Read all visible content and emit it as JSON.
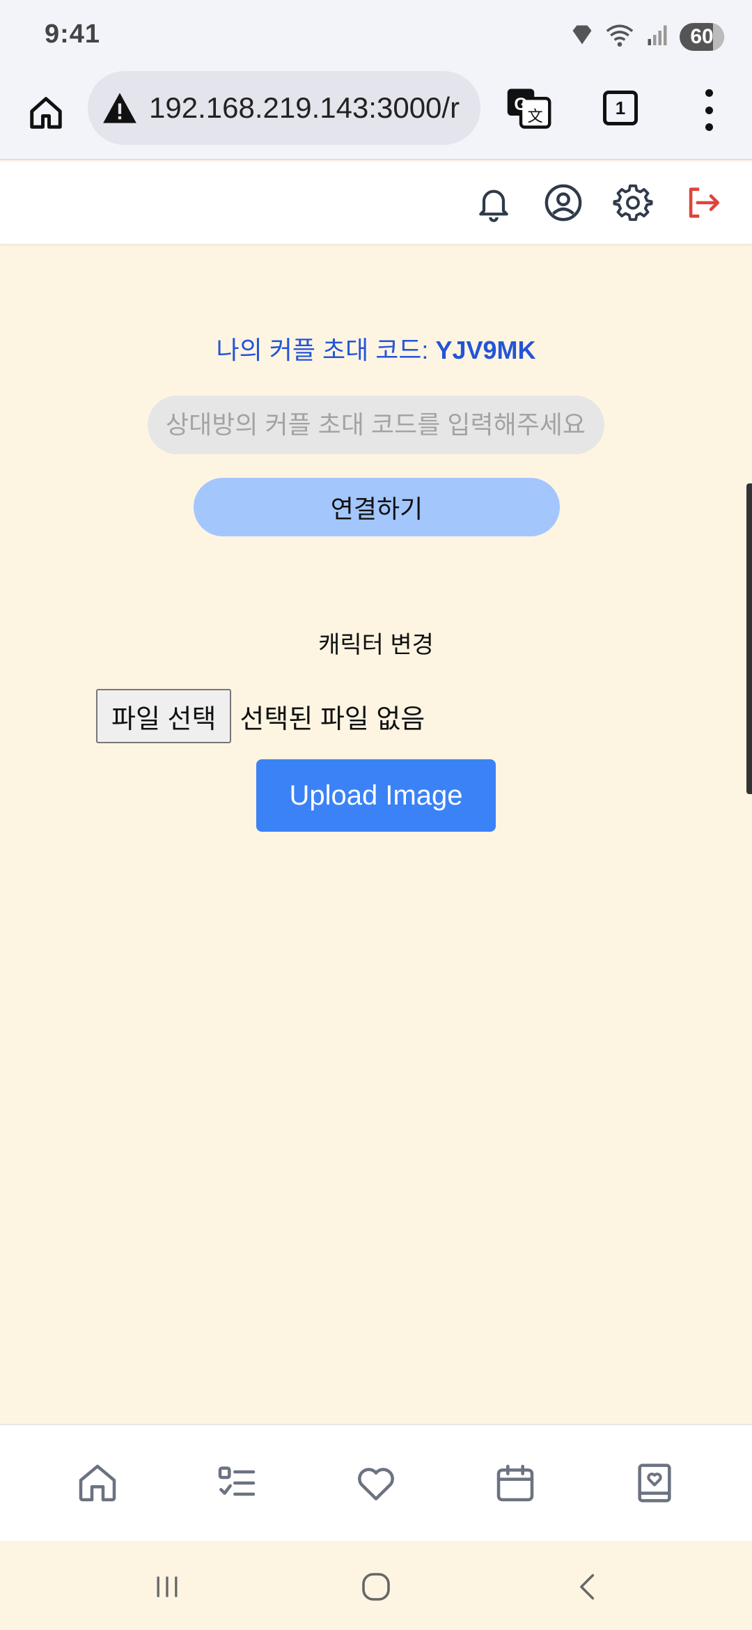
{
  "status_bar": {
    "time": "9:41",
    "battery": "60",
    "icons": [
      "signal-diamond-icon",
      "wifi-icon",
      "cell-signal-icon",
      "battery-icon"
    ]
  },
  "browser": {
    "url": "192.168.219.143:3000/r",
    "url_warning_icon": "warning-icon",
    "tab_count": "1"
  },
  "header": {
    "icons": [
      "bell-icon",
      "profile-icon",
      "settings-icon",
      "logout-icon"
    ],
    "logout_color": "#e0443a"
  },
  "invite": {
    "label": "나의 커플 초대 코드: ",
    "code": "YJV9MK",
    "input_placeholder": "상대방의 커플 초대 코드를 입력해주세요",
    "connect_label": "연결하기"
  },
  "character": {
    "title": "캐릭터 변경",
    "file_button_label": "파일 선택",
    "file_status": "선택된 파일 없음",
    "upload_label": "Upload Image"
  },
  "bottom_nav": {
    "items": [
      "home-icon",
      "checklist-icon",
      "heart-icon",
      "calendar-icon",
      "diary-icon"
    ]
  },
  "colors": {
    "background": "#fdf5e2",
    "accent_blue": "#3b82f6",
    "invite_text": "#2454d6",
    "connect_button": "#a3c6fd"
  }
}
